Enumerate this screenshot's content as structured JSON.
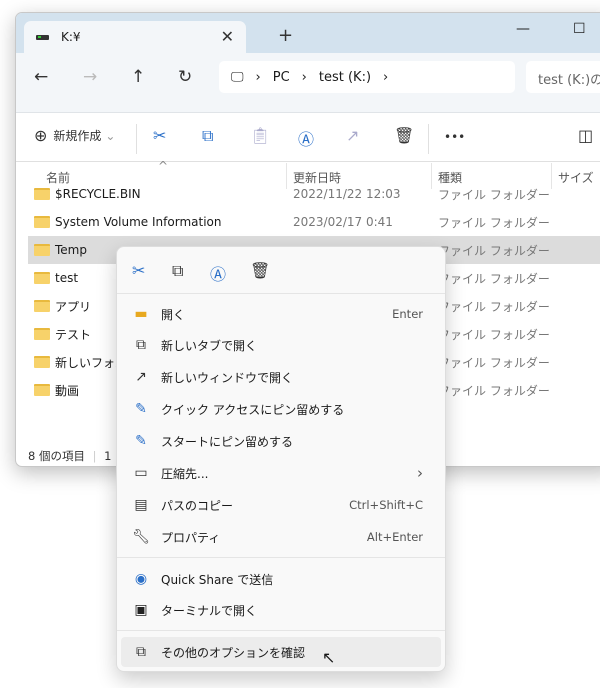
{
  "window": {
    "tab_title": "K:¥",
    "new_tab": "+",
    "minimize": "—",
    "maximize": "☐"
  },
  "nav": {
    "back": "←",
    "forward": "→",
    "up": "↑",
    "refresh": "↻",
    "breadcrumb": [
      "PC",
      "test (K:)"
    ],
    "search_placeholder": "test (K:)の"
  },
  "toolbar": {
    "new_label": "新規作成",
    "more": "•••"
  },
  "columns": [
    "名前",
    "更新日時",
    "種類",
    "サイズ"
  ],
  "files": [
    {
      "name": "$RECYCLE.BIN",
      "date": "2022/11/22 12:03",
      "type": "ファイル フォルダー"
    },
    {
      "name": "System Volume Information",
      "date": "2023/02/17 0:41",
      "type": "ファイル フォルダー"
    },
    {
      "name": "Temp",
      "date": "",
      "type": "ファイル フォルダー",
      "selected": true
    },
    {
      "name": "test",
      "date": "",
      "type": "ファイル フォルダー"
    },
    {
      "name": "アプリ",
      "date": "",
      "type": "ファイル フォルダー"
    },
    {
      "name": "テスト",
      "date": "",
      "type": "ファイル フォルダー"
    },
    {
      "name": "新しいフォルダ",
      "date": "",
      "type": "ファイル フォルダー"
    },
    {
      "name": "動画",
      "date": "",
      "type": "ファイル フォルダー"
    }
  ],
  "status": {
    "count": "8 個の項目",
    "selected": "1"
  },
  "context_menu": {
    "items": [
      {
        "label": "開く",
        "shortcut": "Enter",
        "icon": "folder-open-icon"
      },
      {
        "label": "新しいタブで開く",
        "shortcut": "",
        "icon": "new-tab-icon"
      },
      {
        "label": "新しいウィンドウで開く",
        "shortcut": "",
        "icon": "new-window-icon"
      },
      {
        "label": "クイック アクセスにピン留めする",
        "shortcut": "",
        "icon": "pin-icon"
      },
      {
        "label": "スタートにピン留めする",
        "shortcut": "",
        "icon": "pin-icon"
      },
      {
        "label": "圧縮先...",
        "shortcut": "›",
        "icon": "zip-icon"
      },
      {
        "label": "パスのコピー",
        "shortcut": "Ctrl+Shift+C",
        "icon": "copy-path-icon"
      },
      {
        "label": "プロパティ",
        "shortcut": "Alt+Enter",
        "icon": "wrench-icon"
      },
      {
        "label": "Quick Share で送信",
        "shortcut": "",
        "icon": "quick-share-icon"
      },
      {
        "label": "ターミナルで開く",
        "shortcut": "",
        "icon": "terminal-icon"
      },
      {
        "label": "その他のオプションを確認",
        "shortcut": "",
        "icon": "more-options-icon"
      }
    ]
  },
  "colors": {
    "accent": "#2a6fc8",
    "tabbar": "#d3e2ee",
    "folder": "#f7d26a"
  }
}
